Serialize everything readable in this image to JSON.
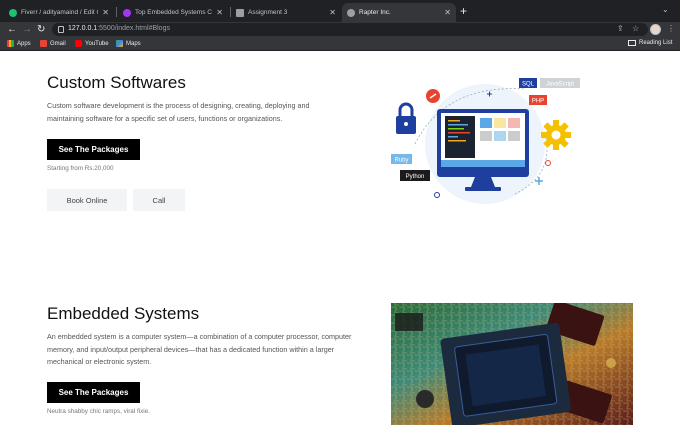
{
  "browser": {
    "tabs": [
      {
        "title": "Fiverr / adityamaind / Edit Gig",
        "favicon_color": "#1dbf73",
        "active": false
      },
      {
        "title": "Top Embedded Systems Cours",
        "favicon_color": "#a435f0",
        "active": false
      },
      {
        "title": "Assignment 3",
        "favicon_color": "#9aa0a6",
        "active": false
      },
      {
        "title": "Rapter Inc.",
        "favicon_color": "#9aa0a6",
        "active": true
      }
    ],
    "url_host": "127.0.0.1",
    "url_rest": ":5500/index.html#Blogs",
    "bookmarks": [
      {
        "label": "Apps",
        "icon": "apps-grid-icon",
        "color": "#ea4335"
      },
      {
        "label": "Gmail",
        "icon": "gmail-icon",
        "color": "#ea4335"
      },
      {
        "label": "YouTube",
        "icon": "youtube-icon",
        "color": "#ff0000"
      },
      {
        "label": "Maps",
        "icon": "maps-icon",
        "color": "#34a853"
      }
    ],
    "reading_list": "Reading List"
  },
  "sections": [
    {
      "title": "Custom Softwares",
      "description": "Custom software development is the process of designing, creating, deploying and maintaining software for a specific set of users, functions or organizations.",
      "button": "See The Packages",
      "note": "Starting from Rs.20,000",
      "actions": [
        "Book Online",
        "Call"
      ]
    },
    {
      "title": "Embedded Systems",
      "description": "An embedded system is a computer system—a combination of a computer processor, computer memory, and input/output peripheral devices—that has a dedicated function within a larger mechanical or electronic system.",
      "button": "See The Packages",
      "note": "Neutra shabby chic ramps, viral fixie."
    }
  ],
  "illustration": {
    "tags": [
      "SQL",
      "JavaScript",
      "PHP",
      "Ruby",
      "Python"
    ]
  },
  "colors": {
    "accent_blue": "#1f3f9e",
    "screen_blue": "#5aa9e6",
    "gear_yellow": "#f5c000",
    "php_red": "#e8432e"
  }
}
